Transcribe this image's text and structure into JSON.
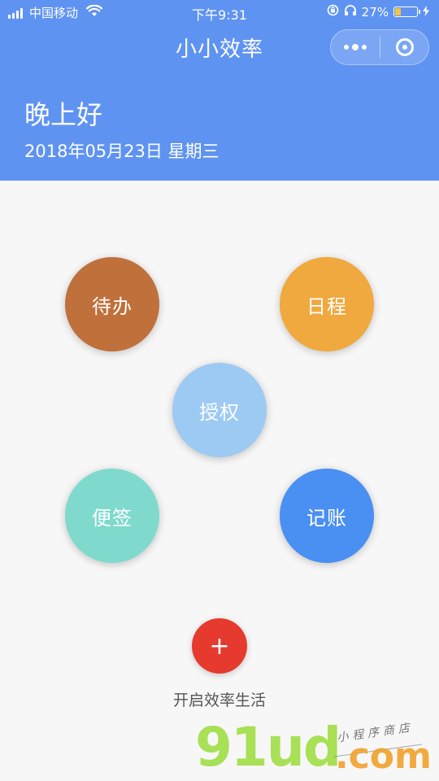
{
  "status_bar": {
    "carrier": "中国移动",
    "time": "下午9:31",
    "battery_percent": "27%",
    "battery_level": 0.27
  },
  "nav": {
    "title": "小小效率"
  },
  "header": {
    "greeting": "晚上好",
    "date": "2018年05月23日 星期三"
  },
  "features": {
    "todo": "待办",
    "schedule": "日程",
    "authorize": "授权",
    "notes": "便签",
    "accounting": "记账"
  },
  "action": {
    "add_symbol": "+",
    "label": "开启效率生活"
  },
  "watermark": {
    "brand": "91ud",
    "domain": ".com",
    "tagline": "小程序商店"
  },
  "colors": {
    "header_bg": "#5f93f2",
    "todo": "#c0703a",
    "schedule": "#efa93e",
    "authorize": "#9dcaf2",
    "notes": "#7fdacd",
    "accounting": "#4a8ff2",
    "add_button": "#e63a2e"
  }
}
